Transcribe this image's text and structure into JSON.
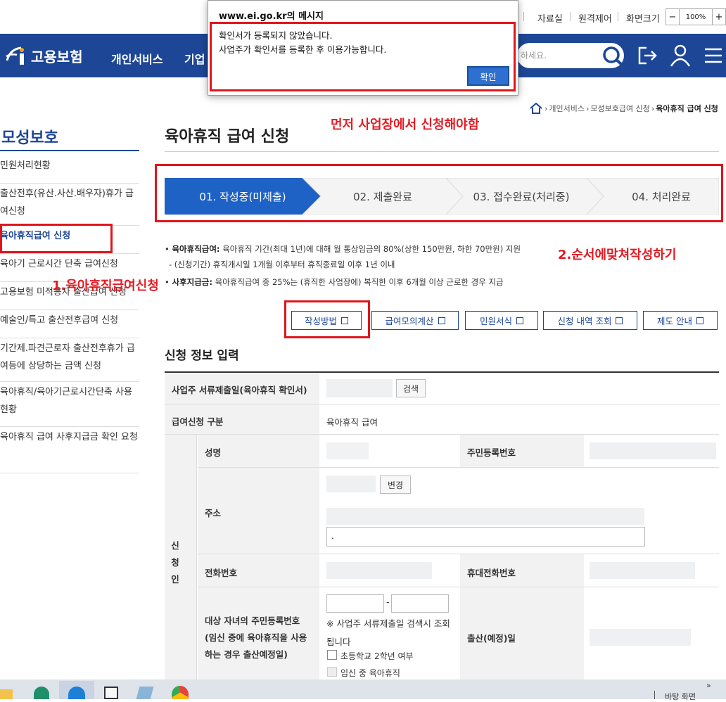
{
  "utility": {
    "items": [
      "자료실",
      "원격제어",
      "화면크기"
    ],
    "zoom_minus": "−",
    "zoom_value": "100%",
    "zoom_plus": "+"
  },
  "header": {
    "logo_text": "고용보험",
    "nav": [
      "개인서비스",
      "기업"
    ],
    "search_placeholder": "하세요.",
    "brand_color": "#1d4696"
  },
  "breadcrumb": {
    "items": [
      "개인서비스",
      "모성보호급여 신청",
      "육아휴직 급여 신청"
    ]
  },
  "sidebar": {
    "title": "모성보호",
    "items": [
      "민원처리현황",
      "출산전후(유산.사산.배우자)휴가 급여신청",
      "육아휴직급여 신청",
      "육아기 근로시간 단축 급여신청",
      "고용보험 미적용자 출산급여 신청",
      "예술인/특고 출산전후급여 신청",
      "기간제.파견근로자 출산전후휴가 급여등에 상당하는 금액 신청",
      "육아휴직/육아기근로시간단축 사용현황",
      "육아휴직 급여 사후지급금 확인 요청"
    ]
  },
  "main": {
    "title": "육아휴직 급여 신청",
    "steps": [
      "01. 작성중(미제출)",
      "02. 제출완료",
      "03. 접수완료(처리중)",
      "04. 처리완료"
    ],
    "bullet1_label": "육아휴직급여:",
    "bullet1_text": "육아휴직 기간(최대 1년)에 대해 월 통상임금의 80%(상한 150만원, 하한 70만원) 지원",
    "bullet1_sub": "- (신청기간) 휴직개시일 1개월 이후부터 휴직종료일 이후 1년 이내",
    "bullet2_label": "사후지급금:",
    "bullet2_text": "육아휴직급여 중 25%는 (휴직한 사업장에) 복직한 이후 6개월 이상 근로한 경우 지급",
    "buttons": [
      "작성방법",
      "급여모의계산",
      "민원서식",
      "신청 내역 조회",
      "제도 안내"
    ],
    "section_title": "신청 정보 입력",
    "form": {
      "row1_label": "사업주 서류제출일(육아휴직 확인서)",
      "search_btn": "검색",
      "row2_label": "급여신청 구분",
      "row2_value": "육아휴직 급여",
      "group_label": "신청인",
      "name_label": "성명",
      "rrn_label": "주민등록번호",
      "address_label": "주소",
      "change_btn": "변경",
      "address_dot": ".",
      "phone_label": "전화번호",
      "mobile_label": "휴대전화번호",
      "child_label": "대상 자녀의 주민등록번호 (임신 중에 육아휴직을 사용하는 경우 출산예정일)",
      "dash": "-",
      "child_note": "※ 사업주 서류제출일 검색시 조회됩니다",
      "check1": "초등학교 2학년 여부",
      "check2": "임신 중 육아휴직",
      "birth_label": "출산(예정)일"
    }
  },
  "annotations": {
    "top": "먼저 사업장에서 신청해야함",
    "steps": "2.순서에맞쳐작성하기",
    "sidebar": "1.육아휴직급여신청",
    "color": "#e31b23"
  },
  "dialog": {
    "title": "www.ei.go.kr의 메시지",
    "message_line1": "확인서가 등록되지 않았습니다.",
    "message_line2": "사업주가 확인서를 등록한 후 이용가능합니다.",
    "ok": "확인"
  },
  "taskbar": {
    "show_desktop": "바탕 화면"
  }
}
